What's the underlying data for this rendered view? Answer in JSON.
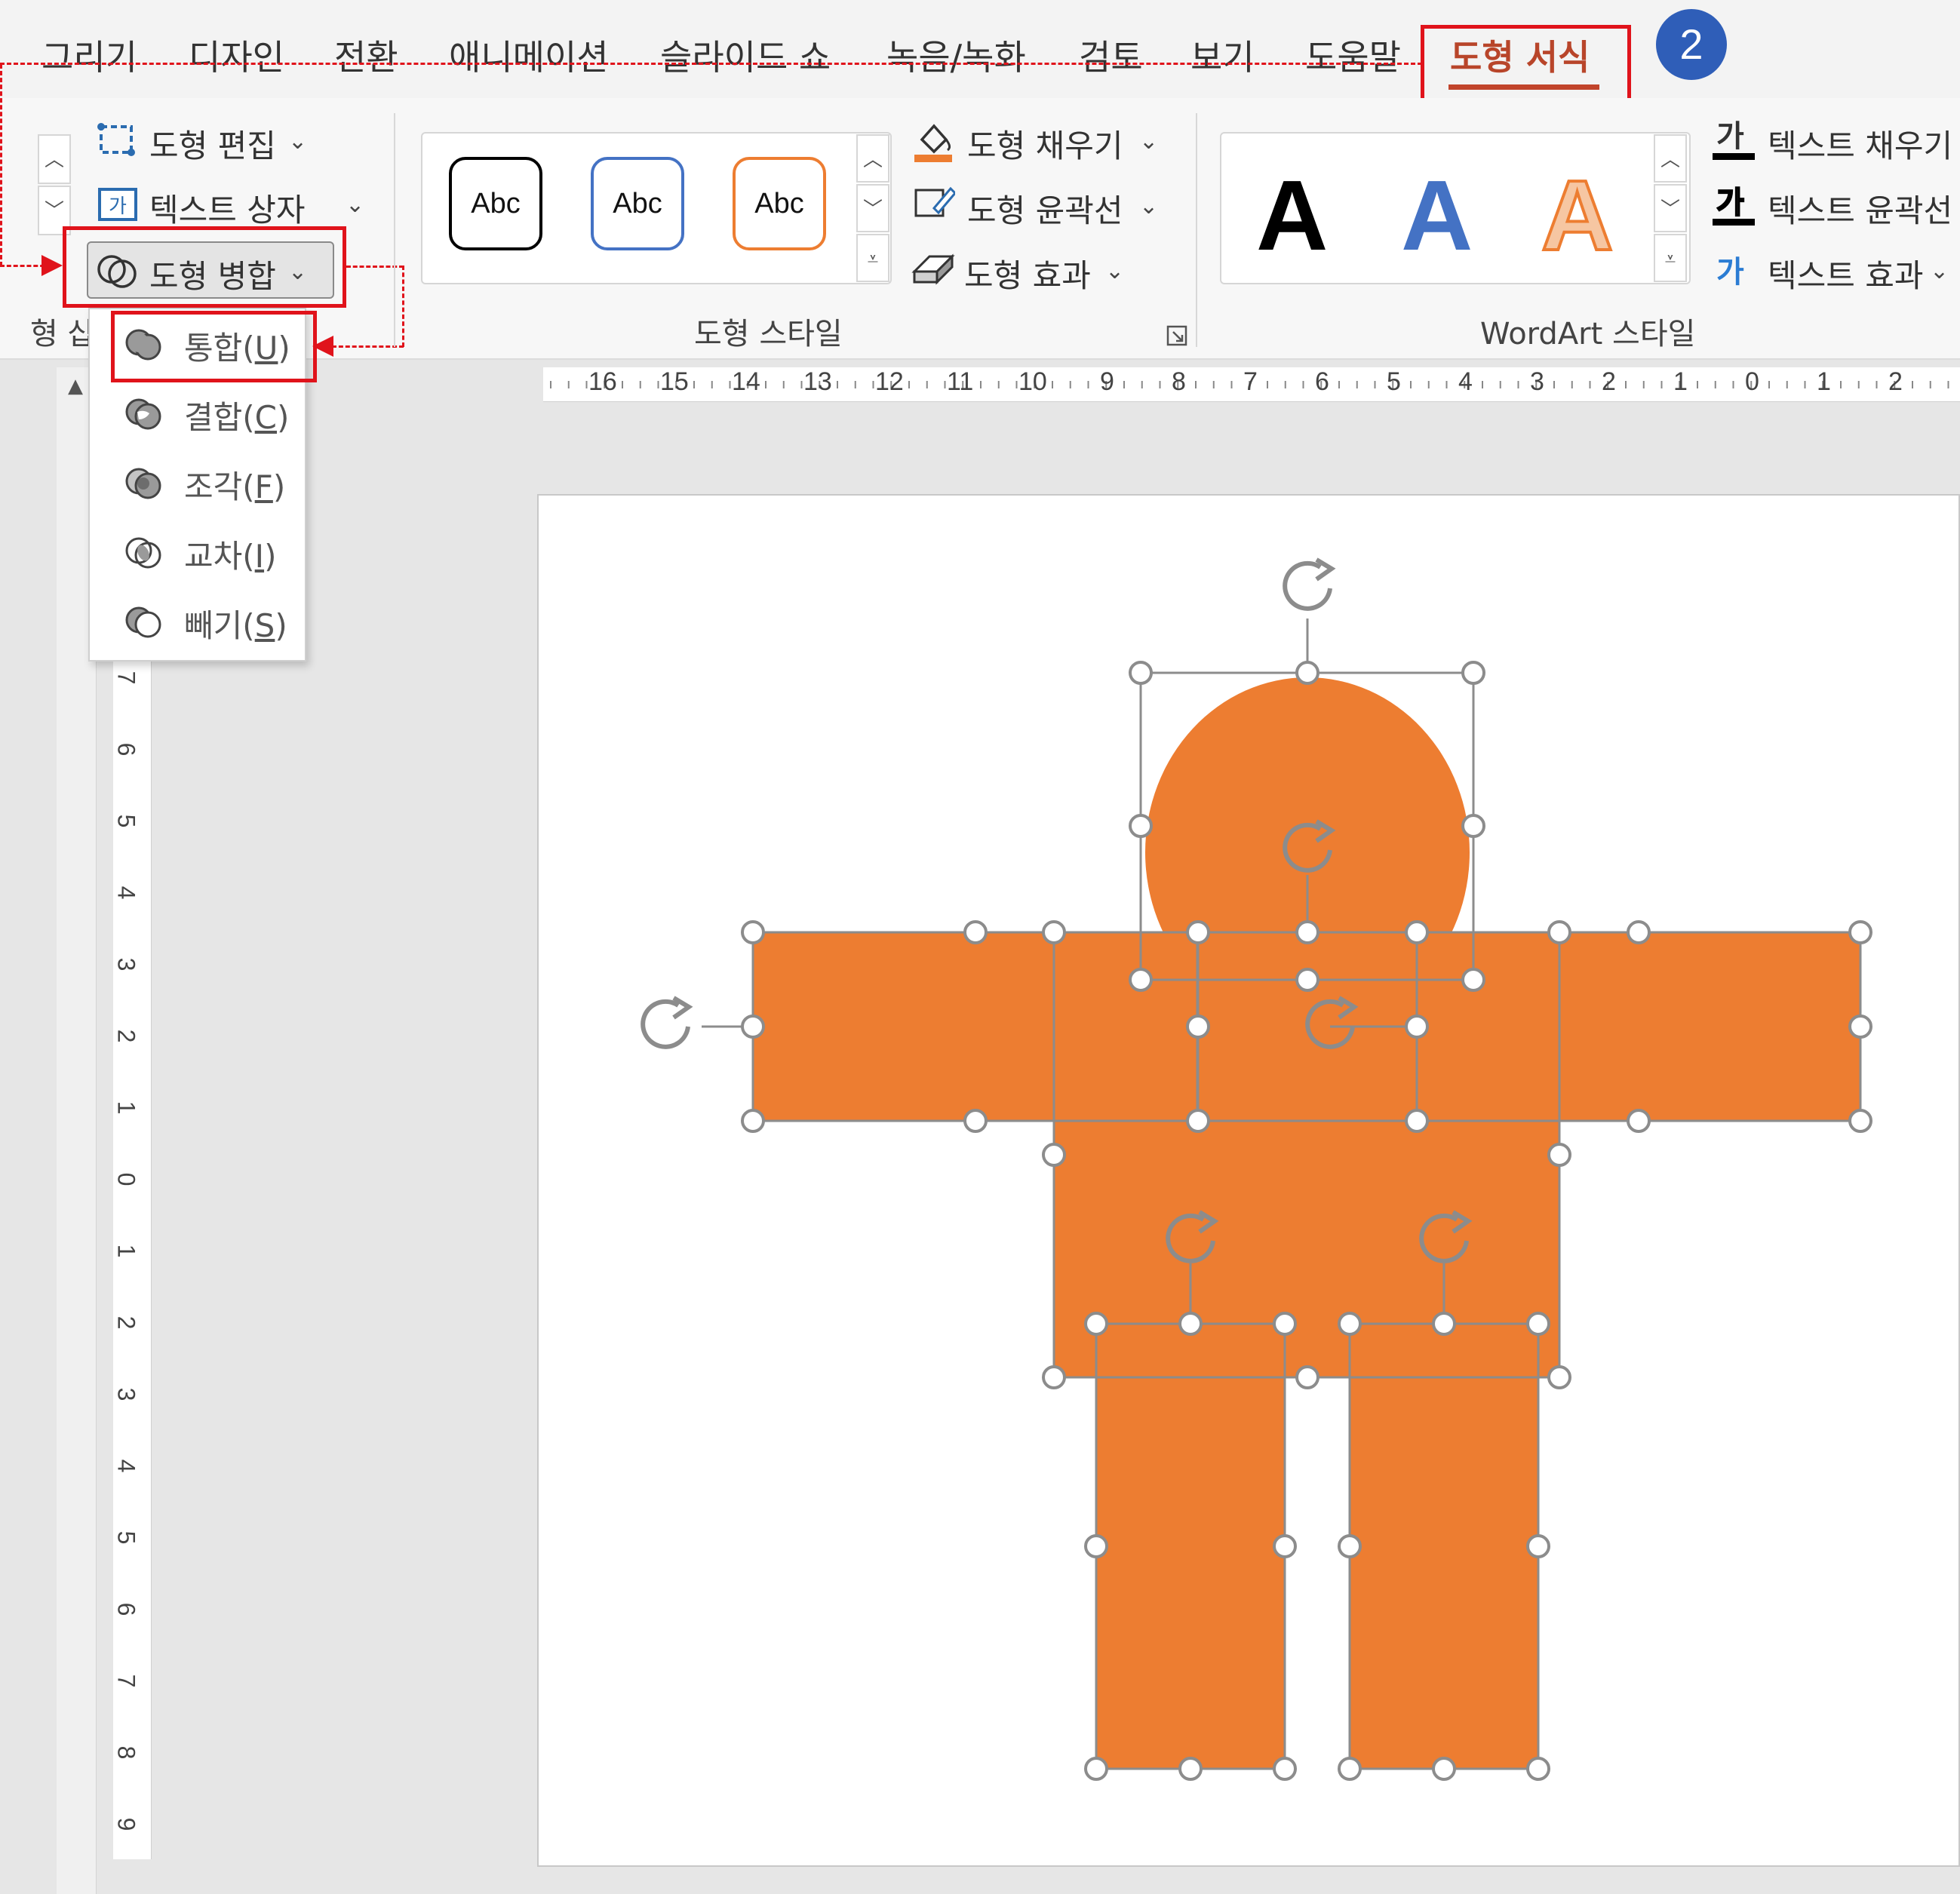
{
  "tabs": [
    {
      "label": "그리기"
    },
    {
      "label": "디자인"
    },
    {
      "label": "전환"
    },
    {
      "label": "애니메이션"
    },
    {
      "label": "슬라이드 쇼"
    },
    {
      "label": "녹음/녹화"
    },
    {
      "label": "검토"
    },
    {
      "label": "보기"
    },
    {
      "label": "도움말"
    },
    {
      "label": "도형 서식",
      "active": true
    }
  ],
  "badge": "2",
  "ribbon": {
    "insert_group": {
      "edit_shape": "도형 편집",
      "text_box": "텍스트 상자",
      "merge_shapes": "도형 병합",
      "group_label_fragment": "형 삽"
    },
    "shape_styles": {
      "samples": [
        "Abc",
        "Abc",
        "Abc"
      ],
      "sample_colors": [
        "#000000",
        "#4472c4",
        "#ed7d31"
      ],
      "fill": "도형 채우기",
      "outline": "도형 윤곽선",
      "effects": "도형 효과",
      "group_label": "도형 스타일"
    },
    "wordart": {
      "samples": [
        "A",
        "A",
        "A"
      ],
      "sample_colors": [
        "#000000",
        "#4472c4",
        "#ed7d31"
      ],
      "text_fill": "텍스트 채우기",
      "text_outline": "텍스트 윤곽선",
      "text_effects": "텍스트 효과",
      "icon_glyph": "가",
      "group_label": "WordArt 스타일"
    }
  },
  "merge_menu": {
    "items": [
      {
        "label": "통합",
        "key": "U",
        "icon": "union-icon"
      },
      {
        "label": "결합",
        "key": "C",
        "icon": "combine-icon"
      },
      {
        "label": "조각",
        "key": "F",
        "icon": "fragment-icon"
      },
      {
        "label": "교차",
        "key": "I",
        "icon": "intersect-icon"
      },
      {
        "label": "빼기",
        "key": "S",
        "icon": "subtract-icon"
      }
    ]
  },
  "ruler": {
    "horizontal": [
      "16",
      "15",
      "14",
      "13",
      "12",
      "11",
      "10",
      "9",
      "8",
      "7",
      "6",
      "5",
      "4",
      "3",
      "2",
      "1",
      "0",
      "1",
      "2"
    ],
    "vertical": [
      "7",
      "6",
      "5",
      "4",
      "3",
      "2",
      "1",
      "0",
      "1",
      "2",
      "3",
      "4",
      "5",
      "6",
      "7",
      "8",
      "9"
    ]
  },
  "colors": {
    "accent_tab": "#c1442b",
    "highlight_box": "#e0131b",
    "badge": "#2f5eb8",
    "shape_fill": "#ed7d31"
  }
}
